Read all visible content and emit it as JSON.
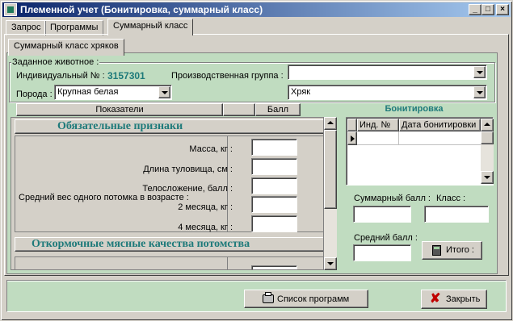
{
  "window": {
    "title": "Племенной учет (Бонитировка, суммарный класс)",
    "controls": {
      "minimize": "_",
      "maximize": "□",
      "close": "×"
    }
  },
  "tabs": [
    "Запрос",
    "Программы",
    "Суммарный класс"
  ],
  "subtabs": [
    "Суммарный класс хряков"
  ],
  "animal": {
    "group_label": "Заданное животное :",
    "individual_label": "Индивидуальный № :",
    "individual_value": "3157301",
    "breed_label": "Порода :",
    "breed_value": "Крупная белая",
    "group_prod_label": "Производственная группа :",
    "group_prod_value": "",
    "sex_value": "Хряк"
  },
  "table_headers": {
    "indicators": "Показатели",
    "score": "Балл",
    "bonitation": "Бонитировка"
  },
  "sections": {
    "mandatory": "Обязательные признаки",
    "fattening": "Откормочные мясные качества потомства"
  },
  "fields": [
    {
      "label": "Масса, кг :",
      "value": ""
    },
    {
      "label": "Длина туловища, см :",
      "value": ""
    },
    {
      "label": "Телосложение, балл :",
      "value": ""
    },
    {
      "label": "2 месяца, кг :",
      "value": ""
    },
    {
      "label": "4 месяца, кг :",
      "value": ""
    }
  ],
  "offspring_label": "Средний вес одного потомка в возрасте :",
  "grid": {
    "col1": "Инд. №",
    "col2": "Дата бонитировки"
  },
  "summary": {
    "total_score_label": "Суммарный балл :",
    "class_label": "Класс :",
    "avg_score_label": "Средний балл :",
    "total_button": "Итого :"
  },
  "footer": {
    "programs_button": "Список программ",
    "close_button": "Закрыть"
  },
  "colors": {
    "panel": "#c0dcc0",
    "teal": "#1e7a7a",
    "title_start": "#0a246a",
    "close_x": "#c00000"
  }
}
